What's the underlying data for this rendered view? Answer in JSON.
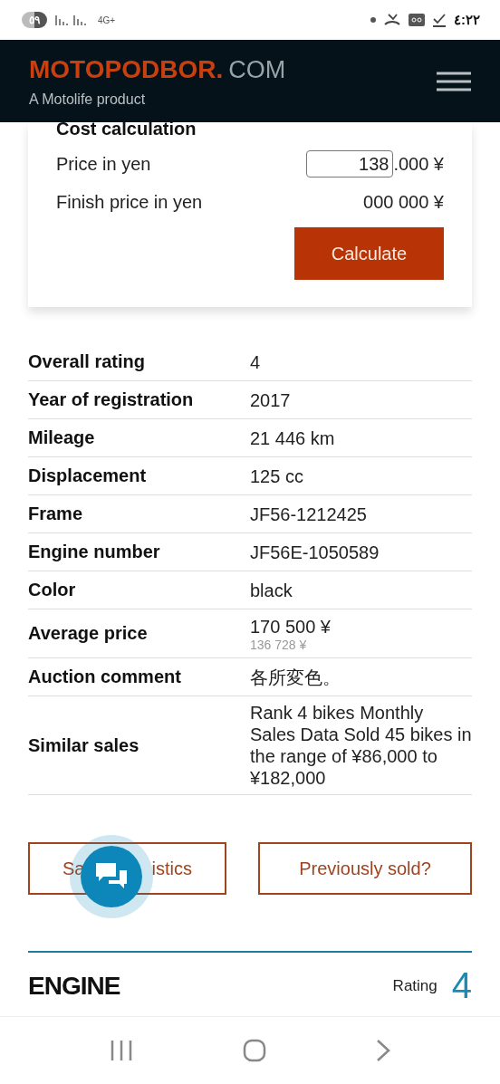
{
  "status_bar": {
    "battery": "٥٩",
    "network": "4G+",
    "time": "٤:٢٢"
  },
  "header": {
    "logo_main": "MOTOPODBOR.",
    "logo_suffix": "COM",
    "tagline": "A Motolife product"
  },
  "cost_calculation": {
    "title": "Cost calculation",
    "price_label": "Price in yen",
    "price_value": "138",
    "price_suffix": ".000 ¥",
    "finish_label": "Finish price in yen",
    "finish_value": "000 000 ¥",
    "button": "Calculate"
  },
  "specs": [
    {
      "label": "Overall rating",
      "value": "4"
    },
    {
      "label": "Year of registration",
      "value": "2017"
    },
    {
      "label": "Mileage",
      "value": "21 446 km"
    },
    {
      "label": "Displacement",
      "value": "125 cc"
    },
    {
      "label": "Frame",
      "value": "JF56-1212425"
    },
    {
      "label": "Engine number",
      "value": "JF56E-1050589"
    },
    {
      "label": "Color",
      "value": "black"
    },
    {
      "label": "Average price",
      "value": "170 500 ¥",
      "subvalue": "136 728 ¥"
    },
    {
      "label": "Auction comment",
      "value": "各所変色。"
    },
    {
      "label": "Similar sales",
      "value": "Rank 4 bikes Monthly Sales Data Sold 45 bikes in the range of ¥86,000 to ¥182,000"
    }
  ],
  "actions": [
    {
      "label_parts": [
        "Sa",
        "istics"
      ]
    },
    {
      "label_parts": [
        "Previously sold?"
      ]
    }
  ],
  "section": {
    "title": "ENGINE",
    "rating_label": "Rating",
    "rating_value": "4"
  }
}
